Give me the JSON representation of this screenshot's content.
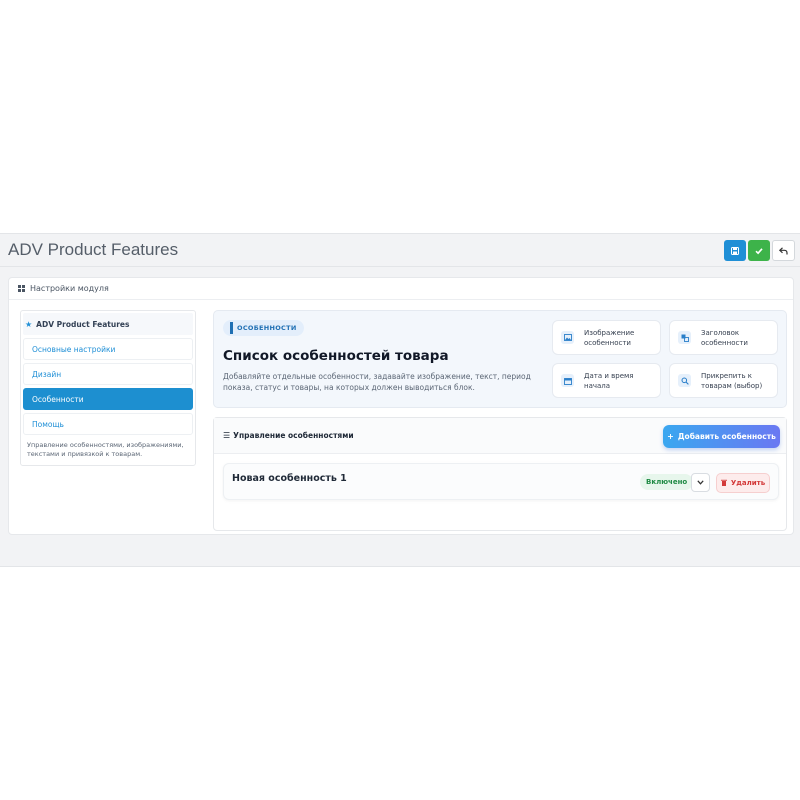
{
  "header": {
    "title": "ADV Product Features",
    "save_icon": "save-icon",
    "ok_icon": "check-icon",
    "back_icon": "back-icon"
  },
  "panel": {
    "title": "Настройки модуля"
  },
  "sidebar": {
    "heading": "ADV Product Features",
    "items": [
      {
        "label": "Основные настройки",
        "active": false
      },
      {
        "label": "Дизайн",
        "active": false
      },
      {
        "label": "Особенности",
        "active": true
      },
      {
        "label": "Помощь",
        "active": false
      }
    ],
    "note": "Управление особенностями, изображениями, текстами и привязкой к товарам."
  },
  "hero": {
    "pill": "ОСОБЕННОСТИ",
    "title": "Список особенностей товара",
    "description": "Добавляйте отдельные особенности, задавайте изображение, текст, период показа, статус и товары, на которых должен выводиться блок.",
    "features": [
      {
        "label": "Изображение особенности",
        "icon": "image-icon"
      },
      {
        "label": "Заголовок особенности",
        "icon": "translate-icon"
      },
      {
        "label": "Дата и время начала",
        "icon": "calendar-icon"
      },
      {
        "label": "Прикрепить к товарам (выбор)",
        "icon": "search-icon"
      }
    ]
  },
  "manage": {
    "title": "Управление особенностями",
    "add_label": "Добавить особенность",
    "items": [
      {
        "title": "Новая особенность 1",
        "status": "Включено",
        "delete_label": "Удалить"
      }
    ]
  },
  "colors": {
    "primary": "#1f8fd6",
    "success": "#3db34a",
    "danger": "#d33a3a"
  }
}
